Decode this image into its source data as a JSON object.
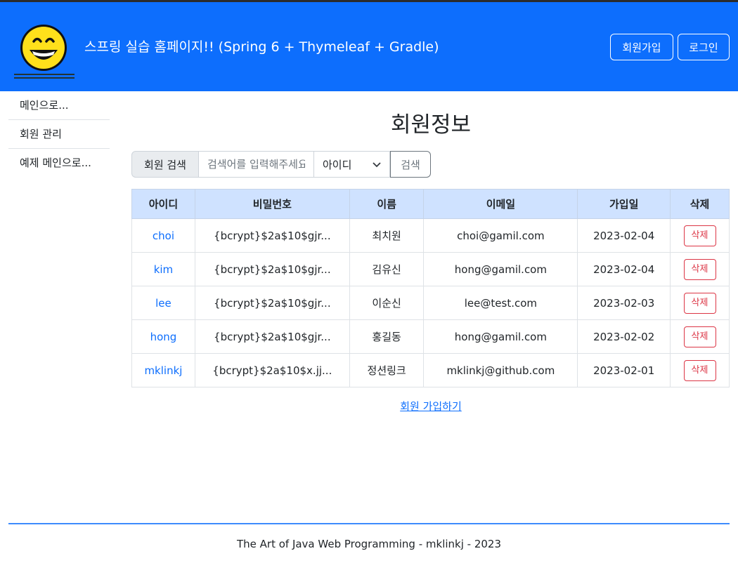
{
  "header": {
    "title": "스프링 실습 홈페이지!! (Spring 6 + Thymeleaf + Gradle)",
    "join_label": "회원가입",
    "login_label": "로그인"
  },
  "sidebar": {
    "items": [
      {
        "label": "메인으로..."
      },
      {
        "label": "회원 관리"
      },
      {
        "label": "예제 메인으로..."
      }
    ]
  },
  "main": {
    "page_title": "회원정보",
    "search": {
      "label": "회원 검색",
      "placeholder": "검색어를 입력해주세요",
      "select_value": "아이디",
      "button_label": "검색"
    },
    "table": {
      "headers": [
        "아이디",
        "비밀번호",
        "이름",
        "이메일",
        "가입일",
        "삭제"
      ],
      "rows": [
        {
          "id": "choi",
          "password": "{bcrypt}$2a$10$gjr...",
          "name": "최치원",
          "email": "choi@gamil.com",
          "joined": "2023-02-04",
          "delete": "삭제"
        },
        {
          "id": "kim",
          "password": "{bcrypt}$2a$10$gjr...",
          "name": "김유신",
          "email": "hong@gamil.com",
          "joined": "2023-02-04",
          "delete": "삭제"
        },
        {
          "id": "lee",
          "password": "{bcrypt}$2a$10$gjr...",
          "name": "이순신",
          "email": "lee@test.com",
          "joined": "2023-02-03",
          "delete": "삭제"
        },
        {
          "id": "hong",
          "password": "{bcrypt}$2a$10$gjr...",
          "name": "홍길동",
          "email": "hong@gamil.com",
          "joined": "2023-02-02",
          "delete": "삭제"
        },
        {
          "id": "mklinkj",
          "password": "{bcrypt}$2a$10$x.jj...",
          "name": "정션링크",
          "email": "mklinkj@github.com",
          "joined": "2023-02-01",
          "delete": "삭제"
        }
      ]
    },
    "join_link": "회원 가입하기"
  },
  "footer": {
    "text": "The Art of Java Web Programming - mklinkj - 2023"
  },
  "colors": {
    "brand": "#0d6efd",
    "table_header": "#cfe2ff",
    "danger": "#dc3545"
  }
}
